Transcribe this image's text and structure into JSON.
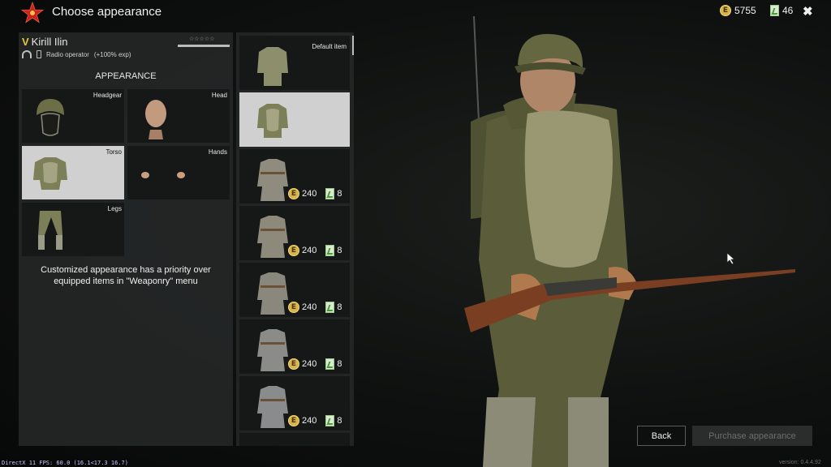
{
  "header": {
    "title": "Choose appearance",
    "coins": "5755",
    "tickets": "46",
    "coin_symbol": "E"
  },
  "soldier": {
    "rank": "V",
    "name": "Kirill Ilin",
    "stars": "☆☆☆☆☆",
    "role": "Radio operator",
    "exp_bonus": "(+100% exp)"
  },
  "appearance": {
    "title": "APPEARANCE",
    "slots": [
      {
        "label": "Headgear"
      },
      {
        "label": "Head"
      },
      {
        "label": "Torso"
      },
      {
        "label": "Hands"
      },
      {
        "label": "Legs"
      }
    ],
    "notice_line1": "Customized appearance has a priority over",
    "notice_line2": "equipped items in \"Weaponry\" menu"
  },
  "items": [
    {
      "label": "Default item"
    },
    {
      "label": ""
    },
    {
      "price": "240",
      "tickets": "8"
    },
    {
      "price": "240",
      "tickets": "8"
    },
    {
      "price": "240",
      "tickets": "8"
    },
    {
      "price": "240",
      "tickets": "8"
    },
    {
      "price": "240",
      "tickets": "8"
    }
  ],
  "footer": {
    "back": "Back",
    "purchase": "Purchase appearance",
    "fps": "DirectX 11 FPS: 60.0 (16.1<17.3 16.7)",
    "version": "version: 0.4.4.92"
  }
}
